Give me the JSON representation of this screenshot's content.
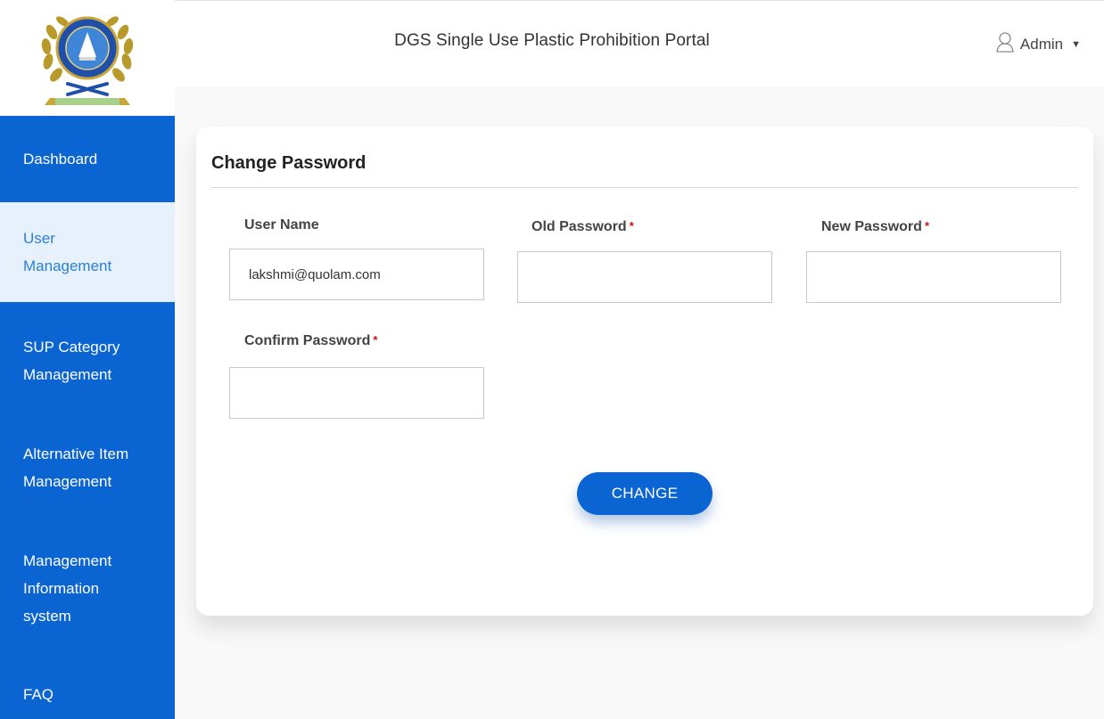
{
  "header": {
    "portal_title": "DGS Single Use Plastic Prohibition Portal",
    "user_label": "Admin"
  },
  "sidebar": {
    "items": [
      {
        "line1": "Dashboard",
        "line2": "",
        "line3": ""
      },
      {
        "line1": "User",
        "line2": "Management",
        "line3": ""
      },
      {
        "line1": "SUP Category",
        "line2": "Management",
        "line3": ""
      },
      {
        "line1": "Alternative Item",
        "line2": "Management",
        "line3": ""
      },
      {
        "line1": "Management",
        "line2": "Information",
        "line3": "system"
      },
      {
        "line1": "FAQ",
        "line2": "",
        "line3": ""
      }
    ],
    "active_index": 1
  },
  "form": {
    "title": "Change Password",
    "user_name": {
      "label": "User Name",
      "value": "lakshmi@quolam.com"
    },
    "old_password": {
      "label": "Old Password",
      "required_mark": "*",
      "value": ""
    },
    "new_password": {
      "label": "New Password",
      "required_mark": "*",
      "value": ""
    },
    "confirm_password": {
      "label": "Confirm Password",
      "required_mark": "*",
      "value": ""
    },
    "submit_label": "CHANGE"
  },
  "colors": {
    "sidebar_bg": "#0a64d2",
    "active_item_bg": "#e6f1fb",
    "active_item_text": "#2a7fd6",
    "required_mark": "#d01010",
    "button_bg": "#0a64d2"
  },
  "icons": {
    "user_menu": "user-outline-icon",
    "dropdown": "caret-down-icon",
    "logo": "dgs-emblem-logo"
  }
}
